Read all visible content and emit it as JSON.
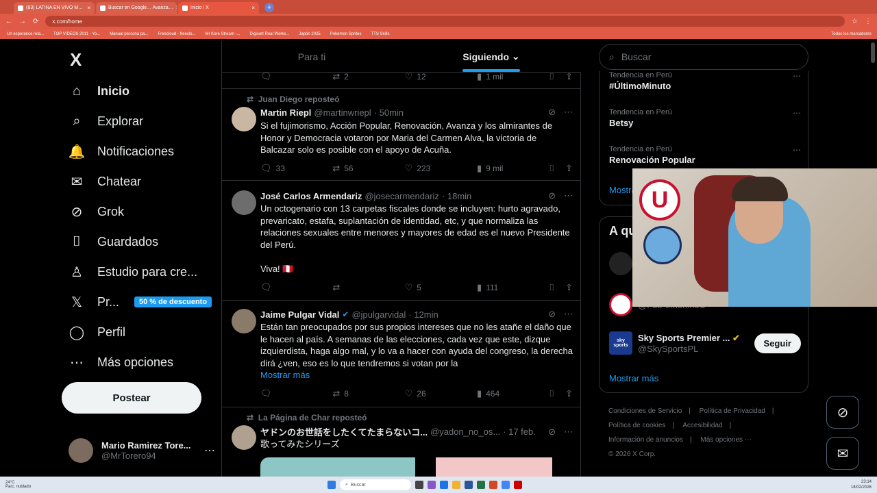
{
  "browser": {
    "tabs": [
      {
        "label": "(83) LATINA EN VIVO M…"
      },
      {
        "label": "Buscar en Google… Avanza…"
      },
      {
        "label": "Inicio / X"
      }
    ],
    "new_tab": "+",
    "url": "x.com/home",
    "bookmarks": [
      "Un esperance rela...",
      "TOP VIDEOS 2011 - Yo...",
      "Manual persona pa...",
      "Freecloud - freeclo...",
      "Mr Kore Stream -...",
      "Digisort Real Works...",
      "Japón 2025",
      "Pokemon Sprites",
      "TTS Skills"
    ],
    "bookmarks_right": "Todos los marcadores"
  },
  "nav": {
    "logo": "X",
    "items": [
      {
        "label": "Inicio",
        "icon": "home-icon",
        "glyph": "⌂"
      },
      {
        "label": "Explorar",
        "icon": "search-icon",
        "glyph": "⌕"
      },
      {
        "label": "Notificaciones",
        "icon": "bell-icon",
        "glyph": "🔔"
      },
      {
        "label": "Chatear",
        "icon": "mail-icon",
        "glyph": "✉"
      },
      {
        "label": "Grok",
        "icon": "grok-icon",
        "glyph": "⊘"
      },
      {
        "label": "Guardados",
        "icon": "bookmark-icon",
        "glyph": "⌷"
      },
      {
        "label": "Estudio para cre...",
        "icon": "creator-studio-icon",
        "glyph": "♙"
      },
      {
        "label": "Pr...",
        "icon": "x-premium-icon",
        "glyph": "𝕏"
      },
      {
        "label": "Perfil",
        "icon": "person-icon",
        "glyph": "◯"
      },
      {
        "label": "Más opciones",
        "icon": "more-options-icon",
        "glyph": "⋯"
      }
    ],
    "promo": "50 % de descuento",
    "post_button": "Postear",
    "user_name": "Mario Ramirez Tore...",
    "user_handle": "@MrTorero94",
    "user_more": "⋯"
  },
  "timeline": {
    "tabs": [
      "Para ti",
      "Siguiendo"
    ],
    "active_tab_chevron": "⌄",
    "top_stats": {
      "replies": "",
      "reposts": "2",
      "likes": "12",
      "views": "1 mil"
    },
    "posts": [
      {
        "repost_by": "Juan Diego reposteó",
        "name": "Martin Riepl",
        "handle": "@martinwriepl",
        "time": "· 50min",
        "text": "Si el fujimorismo, Acción Popular, Renovación, Avanza y los almirantes de Honor y Democracia votaron por Maria del Carmen Alva,  la victoria de Balcazar solo es posible con el apoyo de Acuña.",
        "replies": "33",
        "reposts": "56",
        "likes": "223",
        "views": "9 mil"
      },
      {
        "repost_by": "",
        "name": "José Carlos Armendariz",
        "handle": "@josecarmendariz",
        "time": "· 18min",
        "text": "Un octogenario con 13 carpetas fiscales donde se incluyen: hurto agravado, prevaricato, estafa, suplantación de identidad, etc, y que normaliza las relaciones sexuales entre menores y mayores de edad es el nuevo Presidente del Perú.\n\nViva! 🇵🇪",
        "replies": "",
        "reposts": "",
        "likes": "5",
        "views": "111"
      },
      {
        "repost_by": "",
        "name": "Jaime Pulgar Vidal",
        "handle": "@jpulgarvidal",
        "time": "· 12min",
        "text": "Están tan preocupados por sus propios intereses que no les atañe el daño que le hacen al país. A semanas de las elecciones, cada vez que este, dizque izquierdista, haga algo mal, y lo va a hacer con ayuda del congreso, la derecha dirá ¿ven, eso es lo que tendremos si votan por la",
        "show_more": "Mostrar más",
        "replies": "",
        "reposts": "8",
        "likes": "26",
        "views": "464"
      },
      {
        "repost_by": "La Página de Char reposteó",
        "name": "ヤドンのお世話をしたくてたまらないコ...",
        "handle": "@yadon_no_os...",
        "time": "· 17 feb.",
        "text": "歌ってみたシリーズ"
      }
    ]
  },
  "right": {
    "search_placeholder": "Buscar",
    "trends": [
      {
        "category": "Tendencia en Perú",
        "title": "#ÚltimoMinuto"
      },
      {
        "category": "Tendencia en Perú",
        "title": "Betsy"
      },
      {
        "category": "Tendencia en Perú",
        "title": "Renovación Popular"
      }
    ],
    "trends_show_more": "Mostrar más",
    "follow_title": "A qu",
    "follow_users": [
      {
        "name": "",
        "handle": ""
      },
      {
        "name": "",
        "handle": "@FutFemeninoU"
      },
      {
        "name": "Sky Sports Premier ...",
        "handle": "@SkySportsPL",
        "button": "Seguir",
        "logo": "sky sports"
      }
    ],
    "follow_show_more": "Mostrar más",
    "footer": [
      "Condiciones de Servicio",
      "Política de Privacidad",
      "Política de cookies",
      "Accesibilidad",
      "Información de anuncios",
      "Más opciones ⋯",
      "© 2026 X Corp."
    ]
  },
  "webcam": {
    "logo1": "U"
  },
  "taskbar": {
    "weather_temp": "24°C",
    "weather_desc": "Parc. nublado",
    "search_placeholder": "Buscar",
    "time": "23:14",
    "date": "18/02/2026"
  },
  "colors": {
    "accent": "#1d9bf0",
    "background": "#000000",
    "browser_frame": "#e05a45"
  }
}
